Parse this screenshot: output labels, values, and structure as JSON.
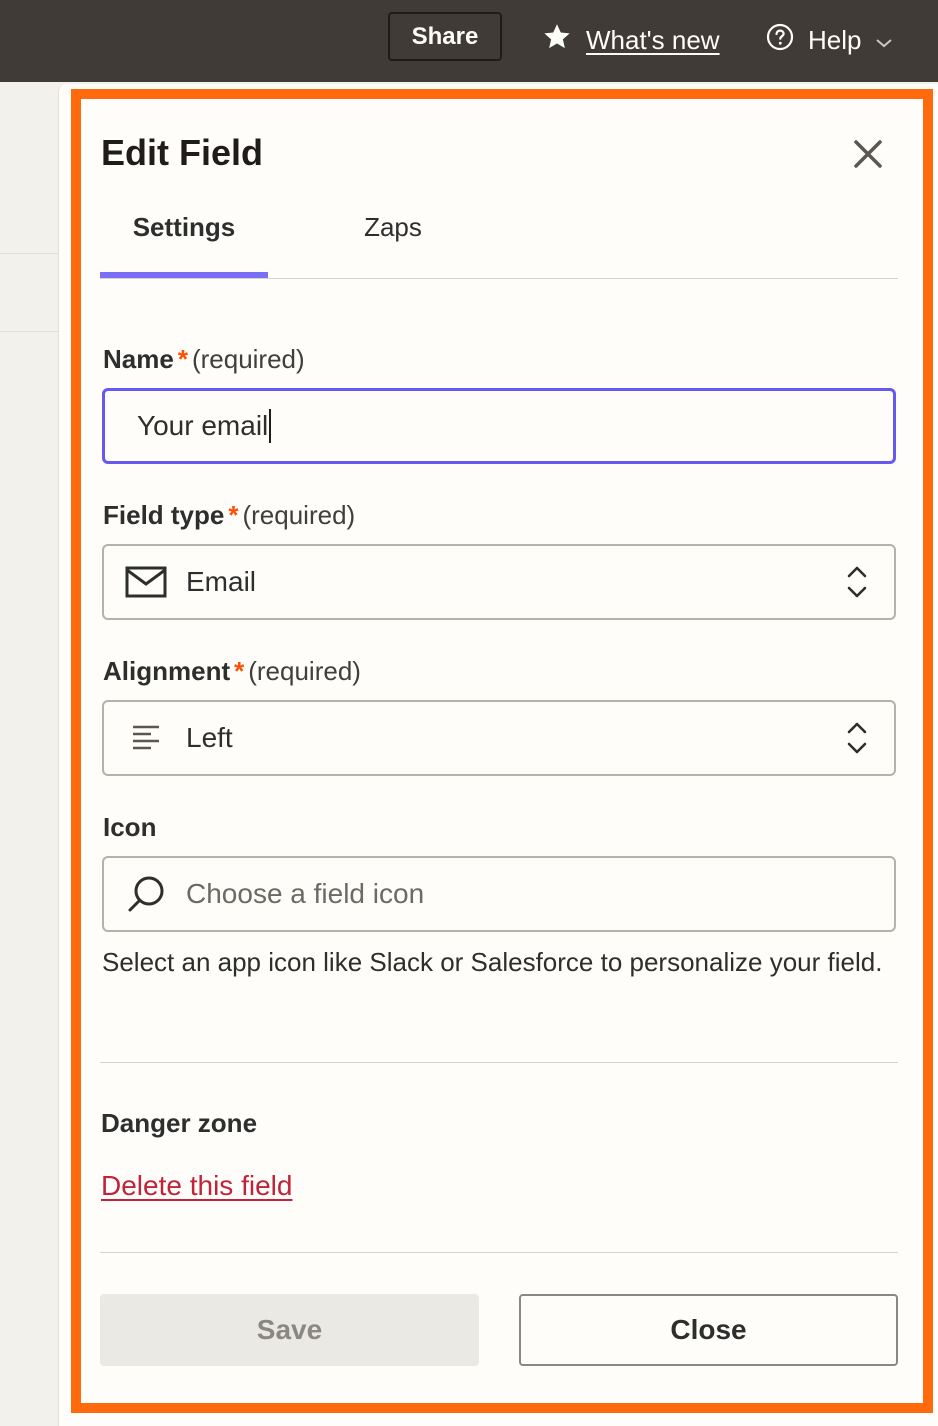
{
  "topbar": {
    "share_label": "Share",
    "whats_new_label": "What's new",
    "help_label": "Help"
  },
  "panel": {
    "title": "Edit Field",
    "tabs": [
      {
        "label": "Settings",
        "active": true
      },
      {
        "label": "Zaps",
        "active": false
      }
    ]
  },
  "form": {
    "name": {
      "label": "Name",
      "required_mark": "*",
      "required_text": "(required)",
      "value": "Your email"
    },
    "field_type": {
      "label": "Field type",
      "required_mark": "*",
      "required_text": "(required)",
      "value": "Email",
      "icon": "envelope-icon"
    },
    "alignment": {
      "label": "Alignment",
      "required_mark": "*",
      "required_text": "(required)",
      "value": "Left",
      "icon": "align-left-icon"
    },
    "icon": {
      "label": "Icon",
      "placeholder": "Choose a field icon",
      "help": "Select an app icon like Slack or Salesforce to personalize your field."
    }
  },
  "danger": {
    "title": "Danger zone",
    "delete_label": "Delete this field"
  },
  "footer": {
    "save_label": "Save",
    "close_label": "Close"
  },
  "colors": {
    "accent": "#6659f0",
    "highlight_frame": "#ff6a0d",
    "required_star": "#ff4f00",
    "danger": "#c0243b",
    "topbar_bg": "#403b37"
  }
}
